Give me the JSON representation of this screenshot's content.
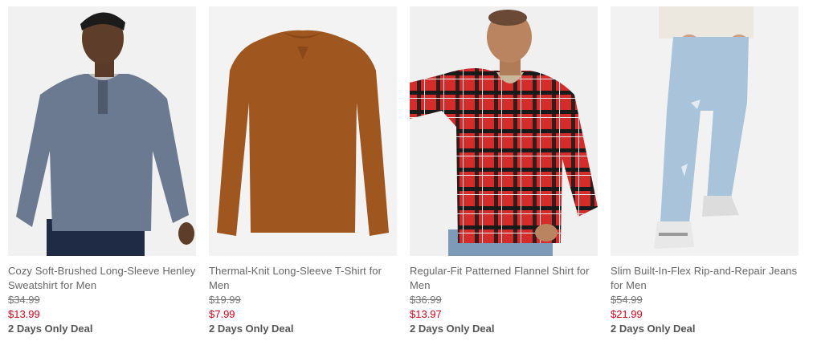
{
  "products": [
    {
      "title": "Cozy Soft-Brushed Long-Sleeve Henley Sweatshirt for Men",
      "original_price": "$34.99",
      "sale_price": "$13.99",
      "deal": "2 Days Only Deal"
    },
    {
      "title": "Thermal-Knit Long-Sleeve T-Shirt for Men",
      "original_price": "$19.99",
      "sale_price": "$7.99",
      "deal": "2 Days Only Deal"
    },
    {
      "title": "Regular-Fit Patterned Flannel Shirt for Men",
      "original_price": "$36.99",
      "sale_price": "$13.97",
      "deal": "2 Days Only Deal"
    },
    {
      "title": "Slim Built-In-Flex Rip-and-Repair Jeans for Men",
      "original_price": "$54.99",
      "sale_price": "$21.99",
      "deal": "2 Days Only Deal"
    }
  ],
  "colors": {
    "sale": "#d0021b",
    "text": "#666666",
    "image_bg": "#f2f2f2"
  }
}
